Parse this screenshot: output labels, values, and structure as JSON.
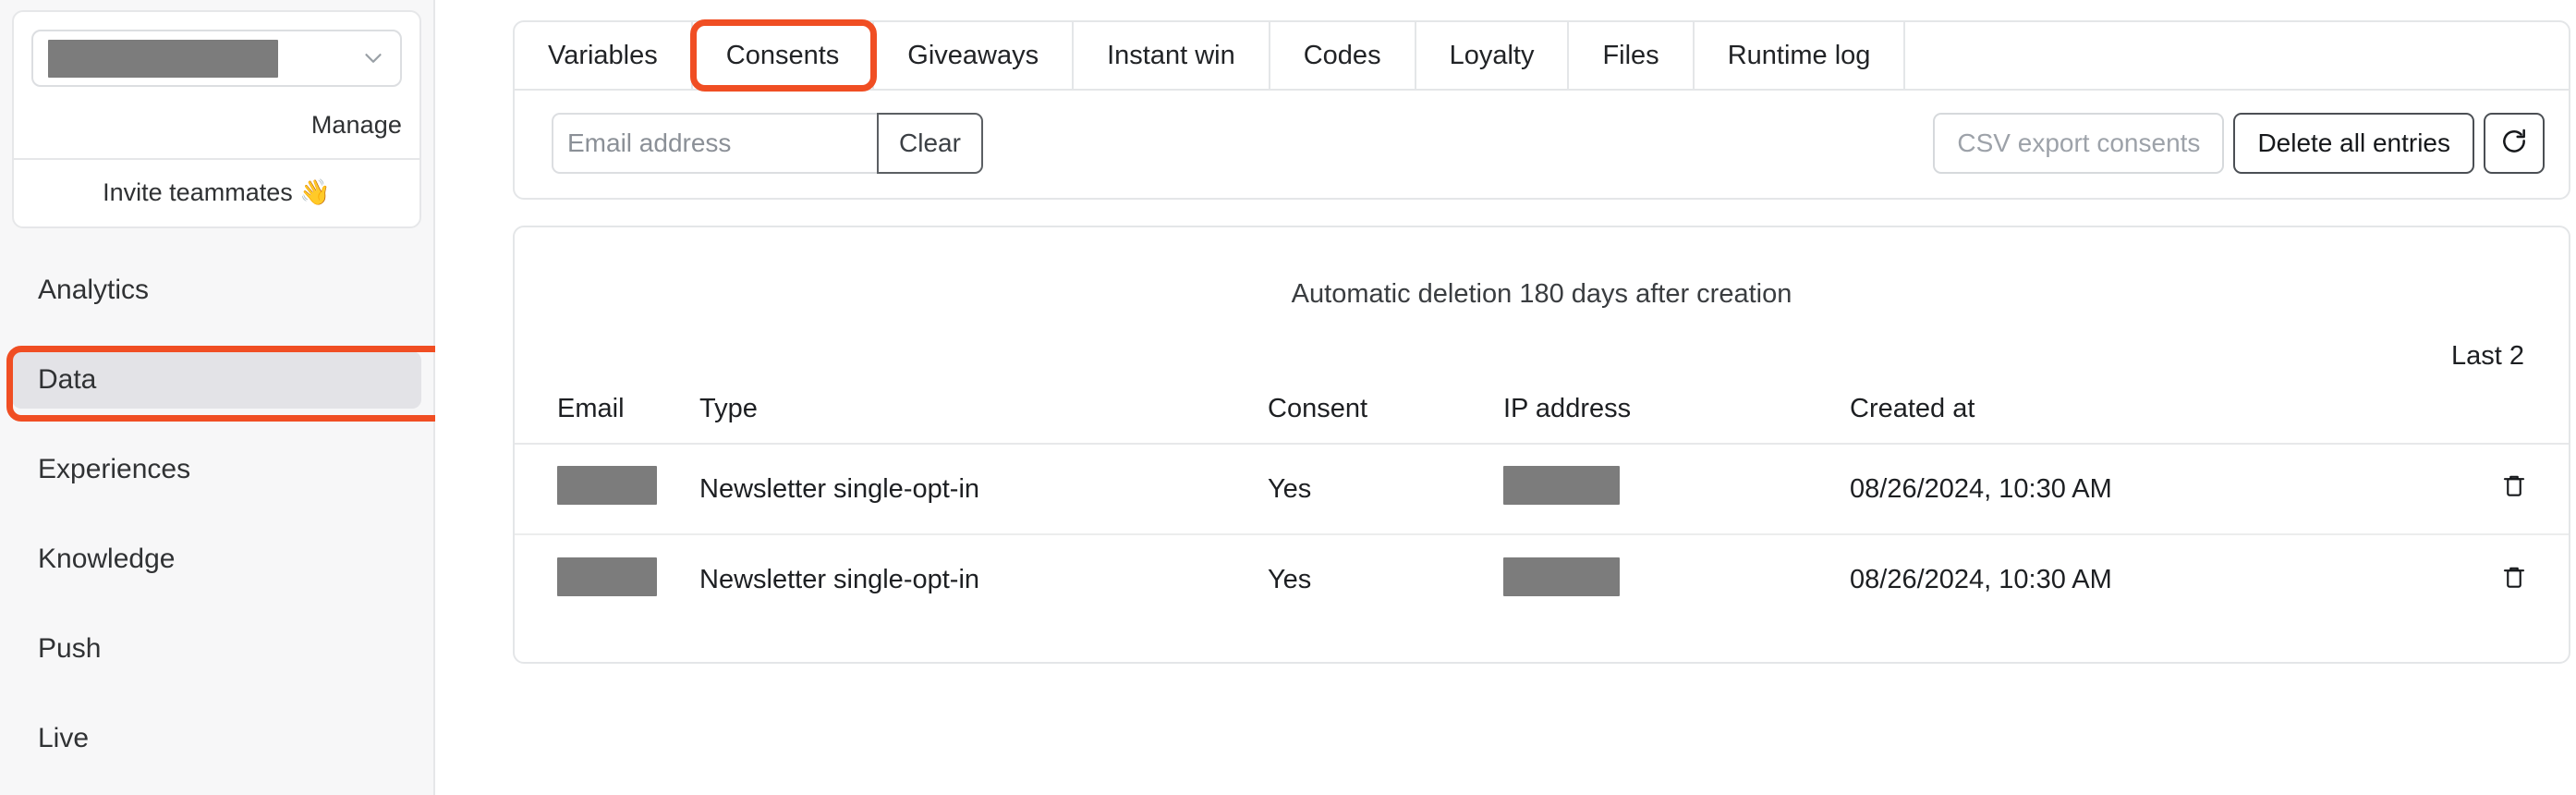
{
  "sidebar": {
    "org_selector": {
      "value_redacted": true,
      "chevron_icon": "chevron-down-icon"
    },
    "manage_label": "Manage",
    "invite_label": "Invite teammates 👋",
    "nav_items": [
      {
        "label": "Analytics",
        "active": false
      },
      {
        "label": "Data",
        "active": true
      },
      {
        "label": "Experiences",
        "active": false
      },
      {
        "label": "Knowledge",
        "active": false
      },
      {
        "label": "Push",
        "active": false
      },
      {
        "label": "Live",
        "active": false
      }
    ]
  },
  "annotations": {
    "color": "#f04e23",
    "targets": [
      "sidebar-item-data",
      "tab-consents"
    ]
  },
  "tabs": [
    {
      "label": "Variables",
      "selected": false,
      "highlighted": false
    },
    {
      "label": "Consents",
      "selected": true,
      "highlighted": true
    },
    {
      "label": "Giveaways",
      "selected": false,
      "highlighted": false
    },
    {
      "label": "Instant win",
      "selected": false,
      "highlighted": false
    },
    {
      "label": "Codes",
      "selected": false,
      "highlighted": false
    },
    {
      "label": "Loyalty",
      "selected": false,
      "highlighted": false
    },
    {
      "label": "Files",
      "selected": false,
      "highlighted": false
    },
    {
      "label": "Runtime log",
      "selected": false,
      "highlighted": false
    }
  ],
  "toolbar": {
    "email_input": {
      "value": "",
      "placeholder": "Email address"
    },
    "clear_label": "Clear",
    "csv_export_label": "CSV export consents",
    "csv_export_disabled": true,
    "delete_all_label": "Delete all entries",
    "refresh_icon": "refresh-icon"
  },
  "table_panel": {
    "auto_deletion_notice": "Automatic deletion 180 days after creation",
    "count_label": "Last 2",
    "columns": [
      "Email",
      "Type",
      "Consent",
      "IP address",
      "Created at"
    ],
    "rows": [
      {
        "email": "",
        "email_redacted": true,
        "type": "Newsletter single-opt-in",
        "consent": "Yes",
        "ip": "",
        "ip_redacted": true,
        "created_at": "08/26/2024, 10:30 AM",
        "delete_icon": "trash-icon"
      },
      {
        "email": "",
        "email_redacted": true,
        "type": "Newsletter single-opt-in",
        "consent": "Yes",
        "ip": "",
        "ip_redacted": true,
        "created_at": "08/26/2024, 10:30 AM",
        "delete_icon": "trash-icon"
      }
    ]
  }
}
